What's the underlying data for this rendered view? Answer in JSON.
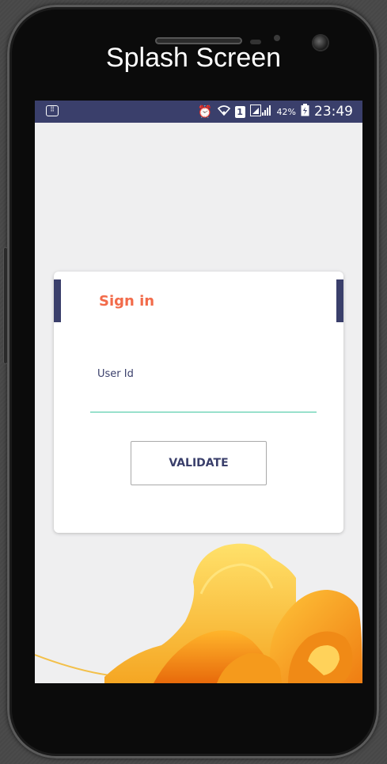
{
  "header": {
    "title": "Splash Screen"
  },
  "status_bar": {
    "icons": [
      "keyboard-icon",
      "alarm-icon",
      "wifi-icon",
      "sim-icon",
      "signal-icon",
      "battery-icon"
    ],
    "sim_label": "1",
    "battery_percent": "42%",
    "time": "23:49",
    "background_color": "#3a3f6b"
  },
  "sign_in_card": {
    "title": "Sign in",
    "user_id_label": "User Id",
    "user_id_value": "",
    "validate_label": "VALIDATE"
  },
  "colors": {
    "accent": "#3a3f6b",
    "title_orange": "#f26b4a",
    "input_underline": "#41c6a0",
    "screen_background": "#efeff0"
  }
}
